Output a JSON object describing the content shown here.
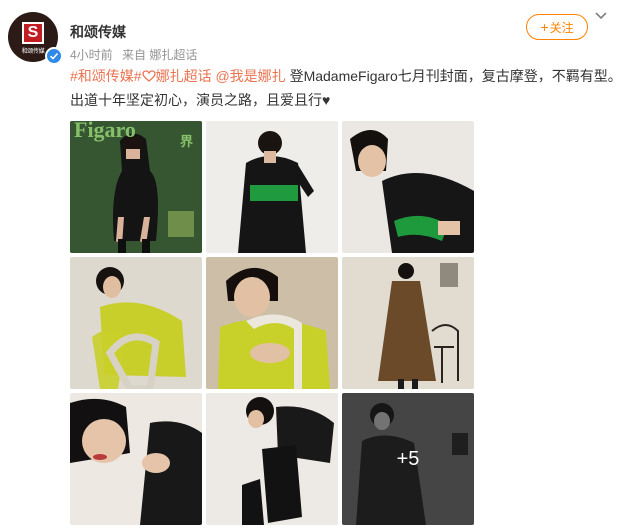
{
  "account": {
    "name": "和颂传媒",
    "time": "4小时前",
    "source": "来自 娜扎超话"
  },
  "actions": {
    "follow_label": "关注"
  },
  "post": {
    "tag1": "#和颂传媒#",
    "tag2": "娜扎超话",
    "mention": "@我是娜扎",
    "body": "登MadameFigaro七月刊封面，复古摩登，不羁有型。出道十年坚定初心，演员之路，且爱且行"
  },
  "media": {
    "cover_title": "Figaro",
    "cover_badge": "界",
    "more_count": "+5",
    "photos": [
      "cover-green-bg",
      "black-dress-green-belt",
      "closeup-green-sleeve",
      "yellow-sweater-chair",
      "yellow-sweater-closeup",
      "brown-trench-coat",
      "closeup-rings",
      "boots-detail",
      "black-white-portrait"
    ]
  },
  "colors": {
    "link": "#eb7350",
    "follow": "#ff8200",
    "verified": "#2e8ae6"
  }
}
